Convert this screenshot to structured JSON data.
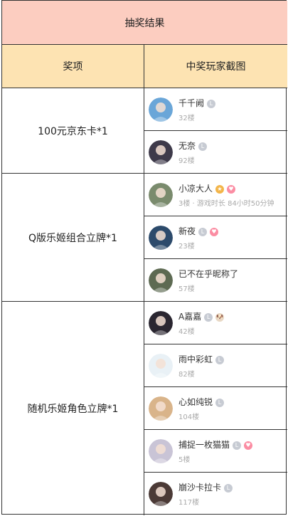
{
  "table": {
    "title": "抽奖结果",
    "headers": {
      "prize": "奖项",
      "winners": "中奖玩家截图"
    }
  },
  "groups": [
    {
      "prize": "100元京东卡*1",
      "winners": [
        {
          "name": "千千阙",
          "sub": "32楼",
          "avatar_color": "#6aa6d8",
          "badges": [
            "level"
          ]
        },
        {
          "name": "无奈",
          "sub": "92楼",
          "avatar_color": "#3e3a4a",
          "badges": [
            "level"
          ]
        }
      ]
    },
    {
      "prize": "Q版乐姬组合立牌*1",
      "winners": [
        {
          "name": "小凉大人",
          "sub": "3楼 · 游戏时长 84小时50分钟",
          "avatar_color": "#7a8b6d",
          "badges": [
            "gold",
            "pink"
          ]
        },
        {
          "name": "新夜",
          "sub": "23楼",
          "avatar_color": "#2c4a6b",
          "badges": [
            "level",
            "pink"
          ]
        },
        {
          "name": "已不在乎昵称了",
          "sub": "57楼",
          "avatar_color": "#5d6a52",
          "badges": []
        }
      ]
    },
    {
      "prize": "随机乐姬角色立牌*1",
      "winners": [
        {
          "name": "A嘉嘉",
          "sub": "42楼",
          "avatar_color": "#2a2630",
          "badges": [
            "level",
            "pup"
          ]
        },
        {
          "name": "雨中彩虹",
          "sub": "82楼",
          "avatar_color": "#e9f1f6",
          "badges": [
            "level"
          ]
        },
        {
          "name": "心如纯锐",
          "sub": "104楼",
          "avatar_color": "#d9b48a",
          "badges": [
            "level"
          ]
        },
        {
          "name": "捕捉一枚猫猫",
          "sub": "5楼",
          "avatar_color": "#c9c4d6",
          "badges": [
            "level",
            "pink"
          ]
        },
        {
          "name": "崩沙卡拉卡",
          "sub": "117楼",
          "avatar_color": "#4b3a36",
          "badges": [
            "level"
          ]
        }
      ]
    }
  ],
  "badge_glyphs": {
    "level": "L",
    "gold": "★",
    "pink": "♥",
    "pup": "🐶"
  }
}
